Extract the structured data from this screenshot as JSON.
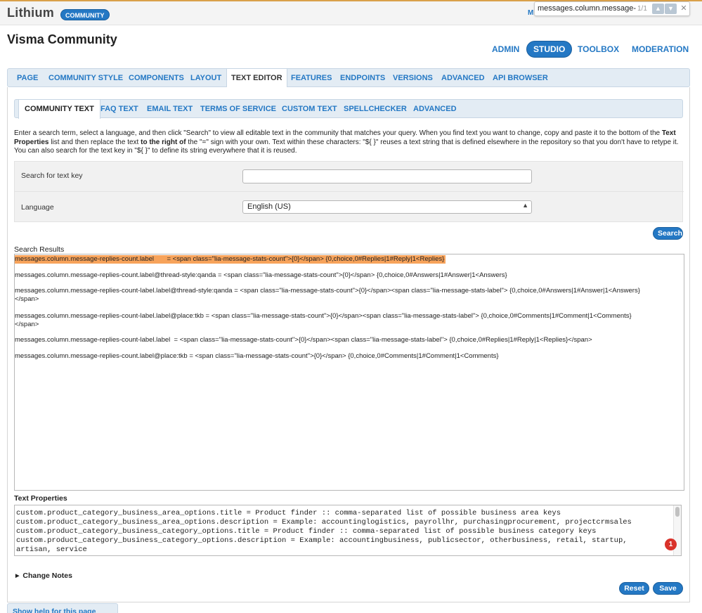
{
  "topbar": {
    "logo": "Lithium",
    "community_badge": "COMMUNITY",
    "truncated_link": "M"
  },
  "findbar": {
    "query": "messages.column.message-re",
    "count": "1/1",
    "prev_icon": "chevron-up",
    "next_icon": "chevron-down",
    "close_icon": "close"
  },
  "header": {
    "title": "Visma Community",
    "nav": {
      "admin": "ADMIN",
      "studio": "STUDIO",
      "toolbox": "TOOLBOX",
      "moderation": "MODERATION"
    }
  },
  "studio_tabs": [
    "PAGE",
    "COMMUNITY STYLE",
    "COMPONENTS",
    "LAYOUT",
    "TEXT EDITOR",
    "FEATURES",
    "ENDPOINTS",
    "VERSIONS",
    "ADVANCED",
    "API BROWSER"
  ],
  "sub_tabs": [
    "COMMUNITY TEXT",
    "FAQ TEXT",
    "EMAIL TEXT",
    "TERMS OF SERVICE",
    "CUSTOM TEXT",
    "SPELLCHECKER",
    "ADVANCED"
  ],
  "instructions": {
    "part1": "Enter a search term, select a language, and then click \"Search\" to view all editable text in the community that matches your query. When you find text you want to change, copy and paste it to the bottom of the ",
    "bold1": "Text Properties",
    "part2": " list and then replace the text ",
    "bold2": "to the right of",
    "part3": " the \"=\" sign with your own. Text within these characters: \"${ }\" reuses a text string that is defined elsewhere in the repository so that you don't have to retype it. You can also search for the text key in \"${ }\" to define its string everywhere that it is reused."
  },
  "form": {
    "search_label": "Search for text key",
    "search_value": "",
    "language_label": "Language",
    "language_value": "English (US)",
    "search_button": "Search"
  },
  "results": {
    "label": "Search Results",
    "lines": [
      "messages.column.message-replies-count.label       = <span class=\"lia-message-stats-count\">{0}</span> {0,choice,0#Replies|1#Reply|1<Replies}",
      "messages.column.message-replies-count.label@thread-style:qanda = <span class=\"lia-message-stats-count\">{0}</span> {0,choice,0#Answers|1#Answer|1<Answers}",
      "messages.column.message-replies-count-label.label@thread-style:qanda = <span class=\"lia-message-stats-count\">{0}</span><span class=\"lia-message-stats-label\"> {0,choice,0#Answers|1#Answer|1<Answers}",
      "</span>",
      "messages.column.message-replies-count-label.label@place:tkb = <span class=\"lia-message-stats-count\">{0}</span><span class=\"lia-message-stats-label\"> {0,choice,0#Comments|1#Comment|1<Comments}",
      "</span>",
      "messages.column.message-replies-count-label.label  = <span class=\"lia-message-stats-count\">{0}</span><span class=\"lia-message-stats-label\"> {0,choice,0#Replies|1#Reply|1<Replies}</span>",
      "messages.column.message-replies-count.label@place:tkb = <span class=\"lia-message-stats-count\">{0}</span> {0,choice,0#Comments|1#Comment|1<Comments}"
    ]
  },
  "text_properties": {
    "label": "Text Properties",
    "lines": [
      "custom.product_category_business_area_options.title = Product finder :: comma-separated list of possible business area keys",
      "custom.product_category_business_area_options.description = Example: accountinglogistics, payrollhr, purchasingprocurement, projectcrmsales",
      "custom.product_category_business_category_options.title = Product finder :: comma-separated list of possible business category keys",
      "custom.product_category_business_category_options.description = Example: accountingbusiness, publicsector, otherbusiness, retail, startup,",
      "artisan, service"
    ],
    "badge_count": "1"
  },
  "change_notes": "Change Notes",
  "buttons": {
    "reset": "Reset",
    "save": "Save"
  },
  "help_tab": "Show help for this page",
  "colors": {
    "accent": "#2478c4",
    "highlight": "#f7a35b",
    "badge": "#d9322a"
  }
}
